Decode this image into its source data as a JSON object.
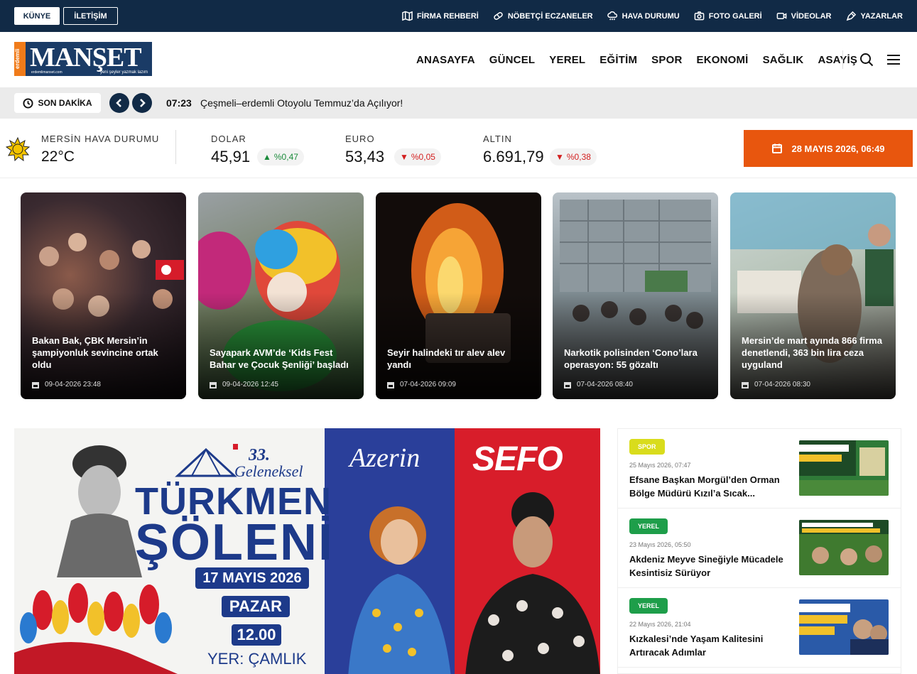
{
  "topbar": {
    "kunye": "KÜNYE",
    "iletisim": "İLETİŞİM",
    "links": [
      {
        "label": "FİRMA REHBERİ",
        "icon": "map-icon"
      },
      {
        "label": "NÖBETÇİ ECZANELER",
        "icon": "pill-icon"
      },
      {
        "label": "HAVA DURUMU",
        "icon": "cloud-rain-icon"
      },
      {
        "label": "FOTO GALERİ",
        "icon": "camera-icon"
      },
      {
        "label": "VİDEOLAR",
        "icon": "video-icon"
      },
      {
        "label": "YAZARLAR",
        "icon": "pen-icon"
      }
    ]
  },
  "header": {
    "logo": {
      "side": "erdemli",
      "word": "MANŞET",
      "slogan": "yeni şeyler yazmak lazım",
      "url": "erdemlimanset.com"
    },
    "nav": [
      "ANASAYFA",
      "GÜNCEL",
      "YEREL",
      "EĞİTİM",
      "SPOR",
      "EKONOMİ",
      "SAĞLIK",
      "ASAYİŞ"
    ]
  },
  "breaking": {
    "label": "SON DAKİKA",
    "time": "07:23",
    "title": "Çeşmeli–erdemli Otoyolu Temmuz’da Açılıyor!"
  },
  "ticker": {
    "weather": {
      "label": "MERSİN HAVA DURUMU",
      "temp": "22°C"
    },
    "markets": [
      {
        "label": "DOLAR",
        "value": "45,91",
        "change": "%0,47",
        "dir": "up",
        "arrow": "▲"
      },
      {
        "label": "EURO",
        "value": "53,43",
        "change": "%0,05",
        "dir": "down",
        "arrow": "▼"
      },
      {
        "label": "ALTIN",
        "value": "6.691,79",
        "change": "%0,38",
        "dir": "down",
        "arrow": "▼"
      }
    ],
    "date": "28 MAYIS 2026, 06:49"
  },
  "cards": [
    {
      "title": "Bakan Bak, ÇBK Mersin’in şampiyonluk sevincine ortak oldu",
      "date": "09-04-2026 23:48"
    },
    {
      "title": "Sayapark AVM’de ‘Kids Fest Bahar ve Çocuk Şenliği’ başladı",
      "date": "09-04-2026 12:45"
    },
    {
      "title": "Seyir halindeki tır alev alev yandı",
      "date": "07-04-2026 09:09"
    },
    {
      "title": "Narkotik polisinden ‘Cono’lara operasyon: 55 gözaltı",
      "date": "07-04-2026 08:40"
    },
    {
      "title": "Mersin’de mart ayında 866 firma denetlendi, 363 bin lira ceza uyguland",
      "date": "07-04-2026 08:30"
    }
  ],
  "banner": {
    "num": "33.",
    "gel": "Geleneksel",
    "turk": "TÜRKMEN",
    "solen": "ŞÖLENİ",
    "date": "17 MAYIS 2026",
    "day": "PAZAR",
    "time": "12.00",
    "yer": "YER: ÇAMLIK",
    "artist1": "Azerin",
    "artist2": "SEFO"
  },
  "side": [
    {
      "cat": "SPOR",
      "catClass": "spor",
      "date": "25 Mayıs 2026, 07:47",
      "title": "Efsane Başkan Morgül’den Orman Bölge Müdürü Kızıl’a Sıcak..."
    },
    {
      "cat": "YEREL",
      "catClass": "yerel",
      "date": "23 Mayıs 2026, 05:50",
      "title": "Akdeniz Meyve Sineğiyle Mücadele Kesintisiz Sürüyor"
    },
    {
      "cat": "YEREL",
      "catClass": "yerel",
      "date": "22 Mayıs 2026, 21:04",
      "title": "Kızkalesi’nde Yaşam Kalitesini Artıracak Adımlar"
    }
  ]
}
